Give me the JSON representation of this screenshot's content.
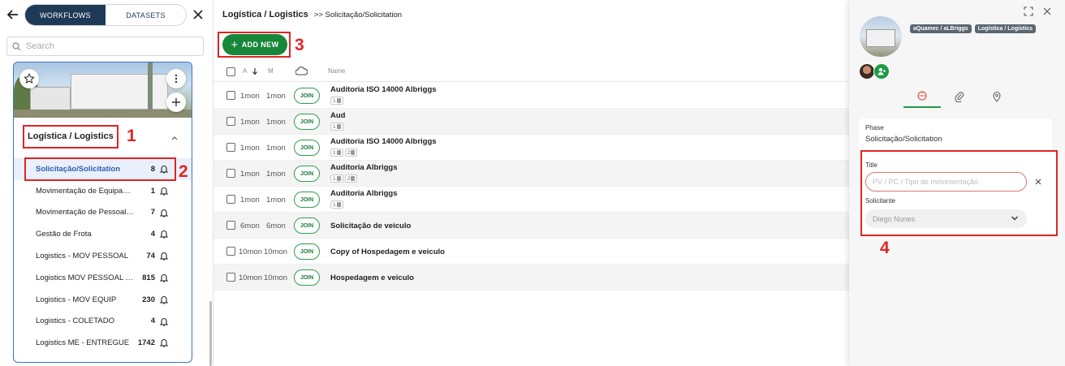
{
  "left": {
    "tabs": [
      "WORKFLOWS",
      "DATASETS"
    ],
    "search_placeholder": "Search",
    "workflow_title": "Logística / Logistics",
    "phases": [
      {
        "label": "Solicitação/Solicitation",
        "count": "8"
      },
      {
        "label": "Movimentação de Equipamentos",
        "count": "1"
      },
      {
        "label": "Movimentação de Pessoal/Personnel",
        "count": "7"
      },
      {
        "label": "Gestão de Frota",
        "count": "4"
      },
      {
        "label": "Logistics - MOV PESSOAL",
        "count": "74"
      },
      {
        "label": "Logistics MOV PESSOAL - ENTREGUE",
        "count": "815"
      },
      {
        "label": "Logistics - MOV EQUIP",
        "count": "230"
      },
      {
        "label": "Logistics - COLETADO",
        "count": "4"
      },
      {
        "label": "Logistics ME - ENTREGUE",
        "count": "1742"
      }
    ]
  },
  "main": {
    "breadcrumb": {
      "workflow": "Logística / Logistics",
      "phase": ">> Solicitação/Solicitation"
    },
    "add_new_label": "ADD NEW",
    "columns": {
      "a": "A",
      "m": "M",
      "name": "Name"
    },
    "join_label": "JOIN",
    "rows": [
      {
        "a": "1mon",
        "m": "1mon",
        "name": "Auditoria ISO 14000 Albriggs",
        "chips": [
          "1"
        ]
      },
      {
        "a": "1mon",
        "m": "1mon",
        "name": "Aud",
        "chips": [
          "1"
        ]
      },
      {
        "a": "1mon",
        "m": "1mon",
        "name": "Auditoria ISO 14000 Albriggs",
        "chips": [
          "1",
          "2"
        ]
      },
      {
        "a": "1mon",
        "m": "1mon",
        "name": "Auditoria Albriggs",
        "chips": [
          "1",
          "2"
        ]
      },
      {
        "a": "1mon",
        "m": "1mon",
        "name": "Auditoria Albriggs",
        "chips": [
          "1"
        ]
      },
      {
        "a": "6mon",
        "m": "6mon",
        "name": "Solicitação de veiculo",
        "chips": []
      },
      {
        "a": "10mon",
        "m": "10mon",
        "name": "Copy of Hospedagem e veiculo",
        "chips": []
      },
      {
        "a": "10mon",
        "m": "10mon",
        "name": "Hospedagem e veiculo",
        "chips": []
      }
    ]
  },
  "right": {
    "tags": [
      "aQuamec / aLBriggs",
      "Logística / Logistics"
    ],
    "phase_label": "Phase",
    "phase_value": "Solicitação/Solicitation",
    "title_label": "Title",
    "title_placeholder": "PV / PC / Tipo de movimentação",
    "solicitante_label": "Solicitante",
    "solicitante_value": "Diego Nunes"
  },
  "annotations": [
    "1",
    "2",
    "3",
    "4"
  ],
  "colors": {
    "accent_green": "#17873a",
    "navy": "#1f3a56",
    "annotation_red": "#e02424",
    "card_border": "#3c74c9"
  }
}
